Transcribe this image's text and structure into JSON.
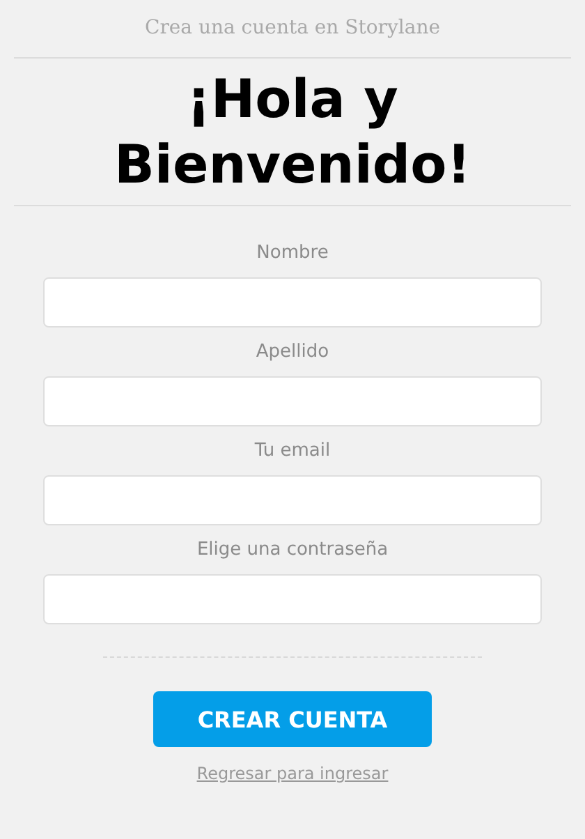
{
  "header": {
    "subtitle": "Crea una cuenta en Storylane",
    "heading": "¡Hola y Bienvenido!"
  },
  "fields": [
    {
      "label": "Nombre"
    },
    {
      "label": "Apellido"
    },
    {
      "label": "Tu email"
    },
    {
      "label": "Elige una contraseña"
    }
  ],
  "submit_button": "CREAR CUENTA",
  "back_link": "Regresar para ingresar"
}
